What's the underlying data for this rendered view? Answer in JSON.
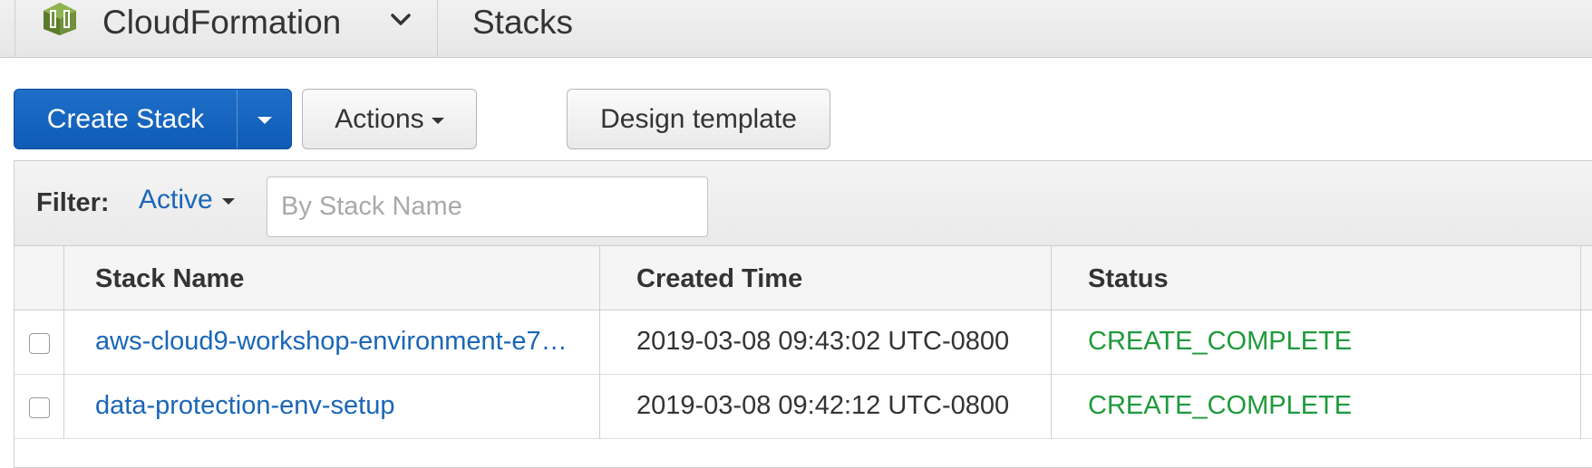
{
  "header": {
    "service_name": "CloudFormation",
    "page_title": "Stacks",
    "logo_icon": "cloudformation-logo-icon",
    "chevron_icon": "chevron-down-icon"
  },
  "toolbar": {
    "create_stack_label": "Create Stack",
    "actions_label": "Actions",
    "design_template_label": "Design template"
  },
  "filter": {
    "label": "Filter:",
    "selected": "Active",
    "search_placeholder": "By Stack Name"
  },
  "table": {
    "columns": [
      "Stack Name",
      "Created Time",
      "Status"
    ],
    "rows": [
      {
        "stack_name": "aws-cloud9-workshop-environment-e7…",
        "created_time": "2019-03-08 09:43:02 UTC-0800",
        "status": "CREATE_COMPLETE"
      },
      {
        "stack_name": "data-protection-env-setup",
        "created_time": "2019-03-08 09:42:12 UTC-0800",
        "status": "CREATE_COMPLETE"
      }
    ]
  },
  "colors": {
    "primary": "#0d5bb5",
    "link": "#1a66b8",
    "status_complete": "#1d9a3a"
  }
}
